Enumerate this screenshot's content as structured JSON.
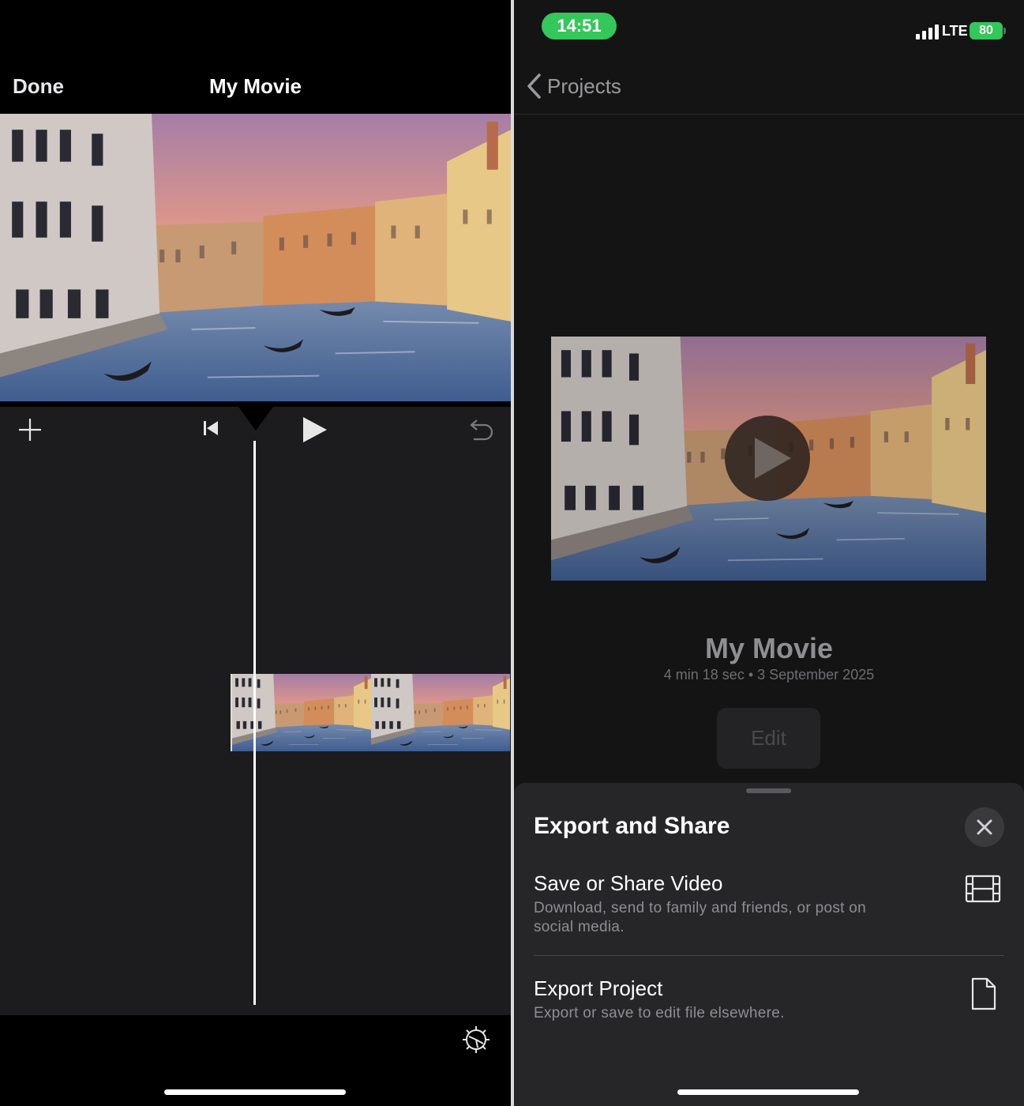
{
  "editor": {
    "done_label": "Done",
    "title": "My Movie"
  },
  "status_bar": {
    "time": "14:51",
    "network": "LTE",
    "battery": "80"
  },
  "project": {
    "back_label": "Projects",
    "title": "My Movie",
    "meta": "4 min 18 sec • 3 September 2025",
    "edit_label": "Edit"
  },
  "sheet": {
    "title": "Export and Share",
    "options": [
      {
        "title": "Save or Share Video",
        "description": "Download, send to family and friends, or post on social media.",
        "icon": "film-icon"
      },
      {
        "title": "Export Project",
        "description": "Export or save to edit file elsewhere.",
        "icon": "document-icon"
      }
    ]
  },
  "colors": {
    "accent_green": "#34c759",
    "sheet_bg": "#262628",
    "editor_bg": "#1c1c1e"
  }
}
